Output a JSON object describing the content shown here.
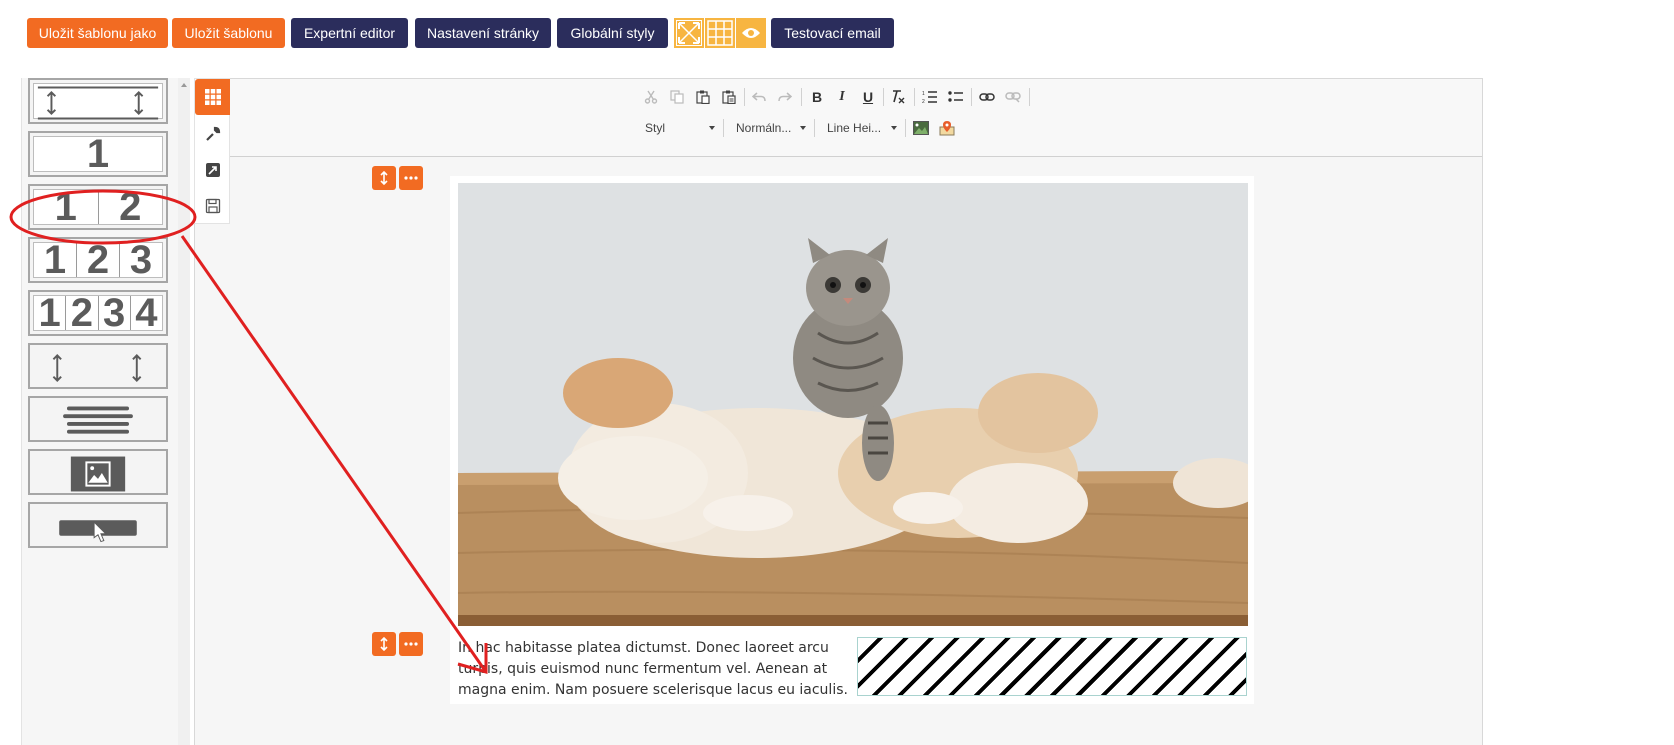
{
  "toolbar": {
    "save_as_label": "Uložit šablonu jako",
    "save_label": "Uložit šablonu",
    "expert_editor_label": "Expertní editor",
    "page_settings_label": "Nastavení stránky",
    "global_styles_label": "Globální styly",
    "test_email_label": "Testovací email",
    "icon_buttons": [
      "fullscreen-icon",
      "grid-icon",
      "eye-icon"
    ]
  },
  "colors": {
    "accent_orange": "#f26b22",
    "navy": "#2b2d5c",
    "icon_yellow": "#f7b541",
    "annotation_red": "#e02020"
  },
  "palette": {
    "blocks": [
      {
        "name": "spacer-with-lines",
        "cells": []
      },
      {
        "name": "one-column",
        "cells": [
          "1"
        ]
      },
      {
        "name": "two-columns",
        "cells": [
          "1",
          "2"
        ]
      },
      {
        "name": "three-columns",
        "cells": [
          "1",
          "2",
          "3"
        ]
      },
      {
        "name": "four-columns",
        "cells": [
          "1",
          "2",
          "3",
          "4"
        ]
      },
      {
        "name": "spacer",
        "cells": []
      },
      {
        "name": "text",
        "cells": []
      },
      {
        "name": "image",
        "cells": []
      },
      {
        "name": "button",
        "cells": []
      }
    ]
  },
  "side_tools": [
    "blocks-grid-icon",
    "wrench-icon",
    "image-edit-icon",
    "save-icon"
  ],
  "editor_toolbar": {
    "row1_icons": [
      "cut-icon",
      "copy-icon",
      "paste-icon",
      "paste-text-icon",
      "undo-icon",
      "redo-icon",
      "bold-icon",
      "italic-icon",
      "underline-icon",
      "remove-format-icon",
      "numbered-list-icon",
      "bulleted-list-icon",
      "link-icon",
      "unlink-icon"
    ],
    "bold_glyph": "B",
    "italic_glyph": "I",
    "underline_glyph": "U",
    "style_combo": "Styl",
    "format_combo": "Normáln...",
    "line_height_combo": "Line Hei...",
    "row2_icons": [
      "image-icon",
      "map-pin-icon"
    ]
  },
  "content": {
    "text_column": "In hac habitasse platea dictumst. Donec laoreet arcu turpis, quis euismod nunc fermentum vel. Aenean at magna enim. Nam posuere scelerisque lacus eu iaculis."
  }
}
